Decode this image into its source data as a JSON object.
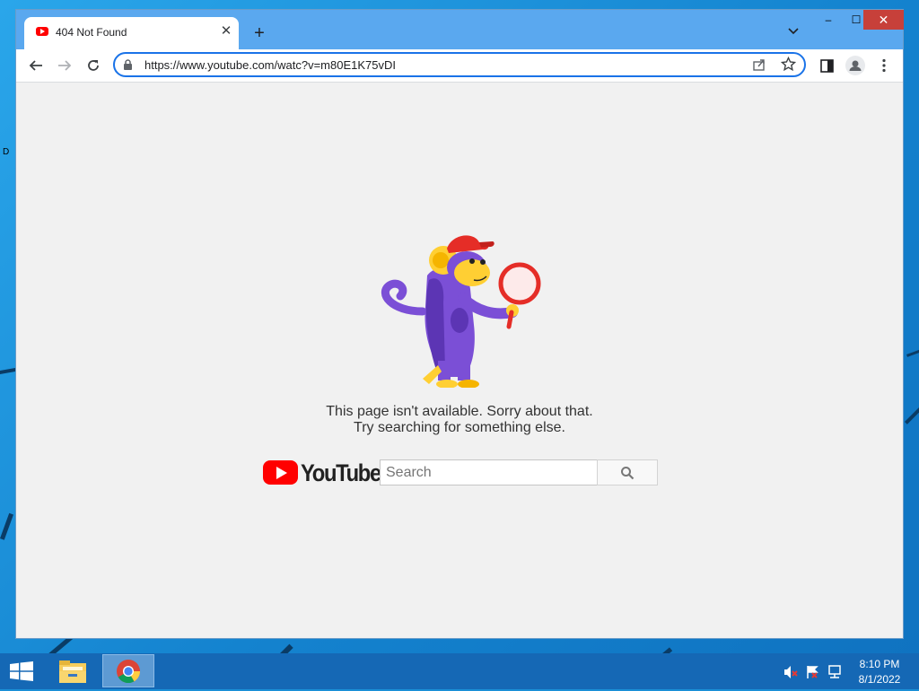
{
  "browser": {
    "tab_title": "404 Not Found",
    "tab_close": "✕",
    "new_tab": "+",
    "url": "https://www.youtube.com/watc?v=m80E1K75vDI",
    "window_minimize": "–",
    "window_maximize": "☐",
    "window_close": "✕"
  },
  "page": {
    "message_line1": "This page isn't available. Sorry about that.",
    "message_line2": "Try searching for something else.",
    "logo_text": "YouTube",
    "search_placeholder": "Search"
  },
  "taskbar": {
    "time": "8:10 PM",
    "date": "8/1/2022"
  },
  "desktop": {
    "edge_label": "D"
  },
  "colors": {
    "youtube_red": "#ff0000",
    "titlebar": "#5aa8ef",
    "taskbar": "#1568b5",
    "omnibox_focus": "#1a73e8"
  }
}
